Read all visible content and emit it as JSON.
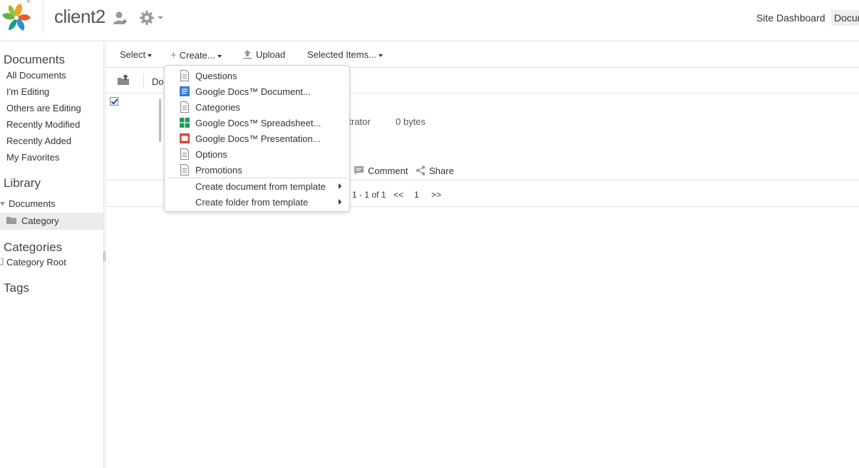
{
  "header": {
    "site_title": "client2",
    "nav_dashboard": "Site Dashboard",
    "nav_documents": "Document Library",
    "colors": {
      "logo_petals": [
        "#f4a020",
        "#e85d2a",
        "#2d8fd1",
        "#65b33f",
        "#1a9a8a",
        "#92c13e",
        "#f2c230"
      ]
    }
  },
  "sidebar": {
    "documents_heading": "Documents",
    "filters": [
      "All Documents",
      "I'm Editing",
      "Others are Editing",
      "Recently Modified",
      "Recently Added",
      "My Favorites"
    ],
    "library_heading": "Library",
    "library_tree": {
      "root": "Documents",
      "child": "Category"
    },
    "categories_heading": "Categories",
    "categories_root": "Category Root",
    "tags_heading": "Tags"
  },
  "toolbar": {
    "select_label": "Select",
    "create_label": "Create...",
    "upload_label": "Upload",
    "selected_items_label": "Selected Items..."
  },
  "subbar": {
    "breadcrumb_partial": "Do"
  },
  "document_row": {
    "modifier_partial": "istrator",
    "size": "0 bytes",
    "comment_label": "Comment",
    "share_label": "Share"
  },
  "pager": {
    "range": "1 - 1 of 1",
    "prev": "<<",
    "page": "1",
    "next": ">>"
  },
  "create_menu": {
    "items": [
      {
        "label": "Questions",
        "icon": "document-icon"
      },
      {
        "label": "Google Docs™ Document...",
        "icon": "google-docs-icon"
      },
      {
        "label": "Categories",
        "icon": "document-icon"
      },
      {
        "label": "Google Docs™ Spreadsheet...",
        "icon": "google-sheets-icon"
      },
      {
        "label": "Google Docs™ Presentation...",
        "icon": "google-slides-icon"
      },
      {
        "label": "Options",
        "icon": "document-icon"
      },
      {
        "label": "Promotions",
        "icon": "document-icon"
      }
    ],
    "submenus": [
      {
        "label": "Create document from template"
      },
      {
        "label": "Create folder from template"
      }
    ]
  }
}
